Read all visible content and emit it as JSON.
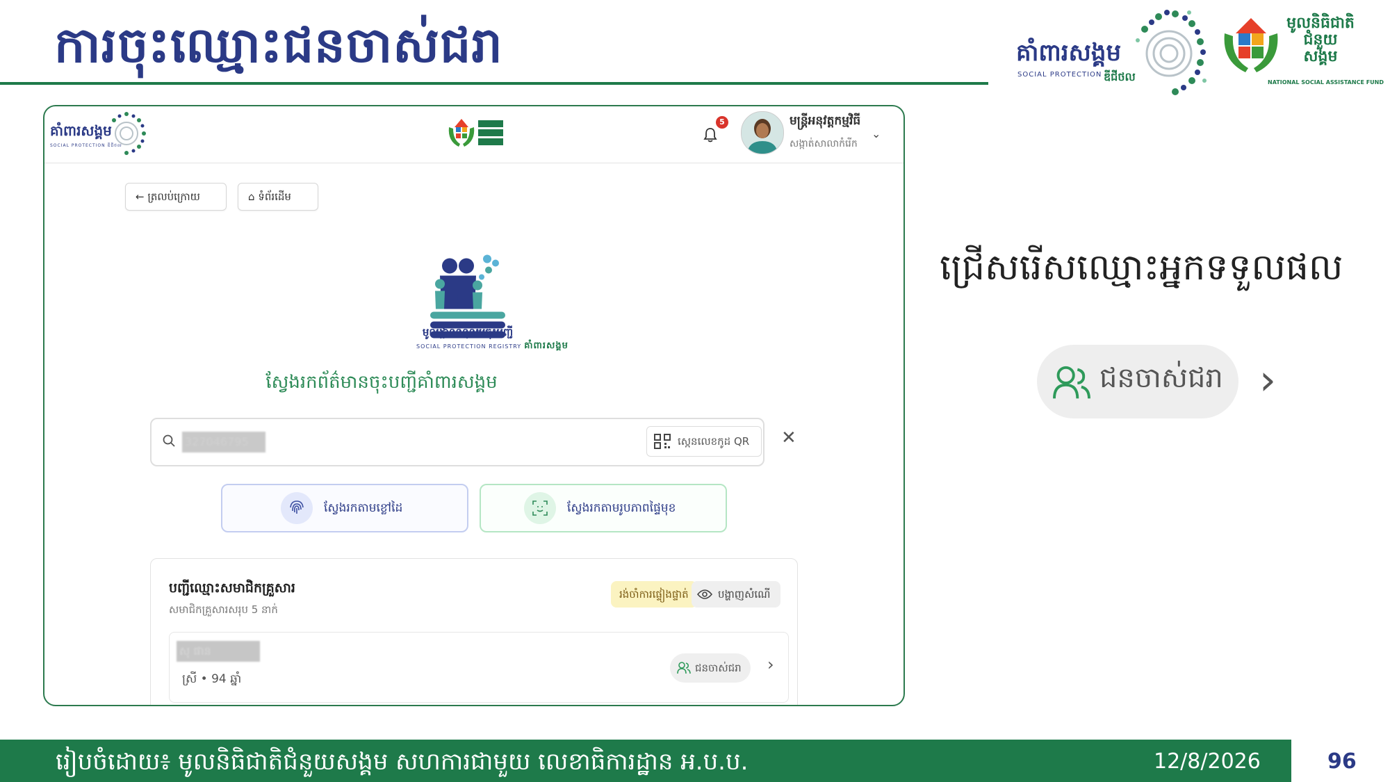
{
  "slide": {
    "title": "ការចុះឈ្មោះជនចាស់ជរា",
    "instruction": "ជ្រើសរើសឈ្មោះអ្នកទទួលផល",
    "callout_tag": "ជនចាស់ជរា",
    "footer_text": "រៀបចំដោយ៖ មូលនិធិជាតិជំនួយសង្គម សហការជាមួយ លេខាធិការដ្ឋាន អ.ប.ប.",
    "footer_date": "12/8/2026",
    "page_number": "96"
  },
  "logos": {
    "sp_name": "គាំពារសង្គម",
    "sp_sub": "SOCIAL PROTECTION",
    "sp_sub2": "ឌីជីថល",
    "nsaf_name": "មូលនិធិជាតិ ជំនួយ សង្គម",
    "nsaf_en": "NATIONAL SOCIAL ASSISTANCE FUND"
  },
  "app": {
    "logo_left": "គាំពារសង្គម",
    "logo_left_sub": "SOCIAL PROTECTION ឌីជីថល",
    "notification_count": "5",
    "user_name": "មន្ត្រីអនុវត្តកម្មវិធី",
    "user_role": "សង្កាត់សាលាកំរើក",
    "back_label": "ត្រលប់ក្រោយ",
    "home_label": "ទំព័រដើម",
    "registry_caption": "មូលដ្ឋានទិន្នន័យចុះបញ្ជី",
    "registry_sub_en": "SOCIAL PROTECTION REGISTRY",
    "registry_sub_kh": "គាំពារសង្គម",
    "search_heading": "ស្វែងរកព័ត៌មានចុះបញ្ជីគាំពារសង្គម",
    "search_value": "327046795",
    "qr_label": "ស្កេនលេខកូដ QR",
    "fingerprint_label": "ស្វែងរកតាមខ្លៅដៃ",
    "face_label": "ស្វែងរកតាមរូបភាពផ្ទៃមុខ",
    "family": {
      "title": "បញ្ជីឈ្មោះសមាជិកគ្រួសារ",
      "count_text": "សមាជិកគ្រួសារសរុប 5 នាក់",
      "weak_badge": "រង់ចាំការផ្ទៀងផ្ទាត់",
      "show_label": "បង្ហាញសំណើ",
      "members": [
        {
          "name": "សុ ផាន",
          "info": "ស្រី • 94 ឆ្នាំ",
          "tag": "ជនចាស់ជរា"
        }
      ]
    }
  }
}
